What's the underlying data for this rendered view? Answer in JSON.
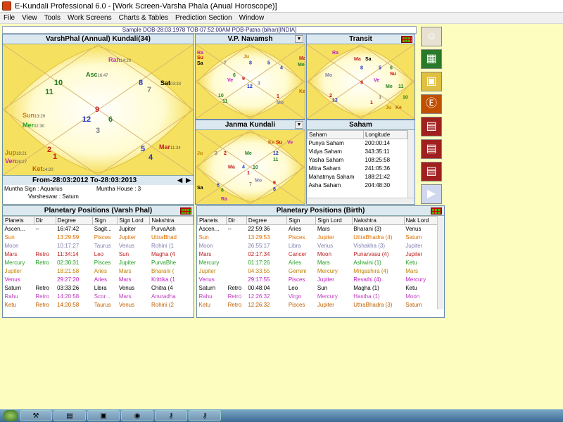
{
  "window": {
    "title": "E-Kundali Professional 6.0 - [Work Screen-Varsha Phala (Anual Horoscope)]"
  },
  "menu": [
    "File",
    "View",
    "Tools",
    "Work Screens",
    "Charts & Tables",
    "Prediction Section",
    "Window"
  ],
  "sample_line": "Sample DOB-28:03:1978 TOB-07:52:00AM POB-Patna (bihar)[INDIA]",
  "varshphal": {
    "title": "VarshPhal (Annual) Kundali(34)",
    "houses": [
      "9",
      "7",
      "8",
      "12",
      "6",
      "3",
      "5",
      "4",
      "1",
      "2",
      "11",
      "10"
    ],
    "planets": [
      {
        "t": "Rah",
        "deg": "14:20",
        "c": "#c040c0"
      },
      {
        "t": "Asc",
        "deg": "16:47",
        "c": "#208020"
      },
      {
        "t": "Sat",
        "deg": "03:33",
        "c": "#000000"
      },
      {
        "t": "Sun",
        "deg": "13:29",
        "c": "#e07000"
      },
      {
        "t": "Mer",
        "deg": "02:30",
        "c": "#20a020"
      },
      {
        "t": "Mar",
        "deg": "11:34",
        "c": "#c02020"
      },
      {
        "t": "Jup",
        "deg": "18:21",
        "c": "#c08000"
      },
      {
        "t": "Ven",
        "deg": "29:27",
        "c": "#c020c0"
      },
      {
        "t": "Ket",
        "deg": "14:20",
        "c": "#c06000"
      },
      {
        "t": "Moo",
        "deg": "10:17",
        "c": "#8080b0"
      }
    ],
    "period": "From-28:03:2012 To-28:03:2013",
    "muntha_sign": "Muntha Sign : Aquarius",
    "muntha_house": "Muntha House : 3",
    "varsheswar": "Varsheswar : Saturn"
  },
  "navamsh": {
    "title": "V.P. Navamsh"
  },
  "transit": {
    "title": "Transit"
  },
  "janma": {
    "title": "Janma Kundali"
  },
  "saham": {
    "title": "Saham",
    "headers": [
      "Saham",
      "Longitude"
    ],
    "rows": [
      [
        "Punya Saham",
        "200:00:14"
      ],
      [
        "Vidya Saham",
        "343:35:11"
      ],
      [
        "Yasha Saham",
        "108:25:58"
      ],
      [
        "Mitra Saham",
        "241:05:36"
      ],
      [
        "Mahatmya Saham",
        "188:21:42"
      ],
      [
        "Asha Saham",
        "204:48:30"
      ]
    ]
  },
  "pp_varsh": {
    "title": "Planetary Positions (Varsh Phal)",
    "headers": [
      "Planets",
      "Dir",
      "Degree",
      "Sign",
      "Sign Lord",
      "Nakshtra"
    ],
    "rows": [
      {
        "c": "#000000",
        "v": [
          "Ascen...",
          "--",
          "16:47:42",
          "Sagit...",
          "Jupiter",
          "PurvaAsh"
        ]
      },
      {
        "c": "#e07000",
        "v": [
          "Sun",
          "",
          "13:29:59",
          "Pisces",
          "Jupiter",
          "UttraBhad"
        ]
      },
      {
        "c": "#8080b0",
        "v": [
          "Moon",
          "",
          "10:17:27",
          "Taurus",
          "Venus",
          "Rohini (1"
        ]
      },
      {
        "c": "#c02020",
        "v": [
          "Mars",
          "Retro",
          "11:34:14",
          "Leo",
          "Sun",
          "Magha (4"
        ]
      },
      {
        "c": "#20a020",
        "v": [
          "Mercury",
          "Retro",
          "02:30:31",
          "Pisces",
          "Jupiter",
          "PurvaBhe"
        ]
      },
      {
        "c": "#c08000",
        "v": [
          "Jupiter",
          "",
          "18:21:58",
          "Aries",
          "Mars",
          "Bharani ("
        ]
      },
      {
        "c": "#c020c0",
        "v": [
          "Venus",
          "",
          "29:27:20",
          "Aries",
          "Mars",
          "Krittika (1"
        ]
      },
      {
        "c": "#000000",
        "v": [
          "Saturn",
          "Retro",
          "03:33:26",
          "Libra",
          "Venus",
          "Chitra (4"
        ]
      },
      {
        "c": "#c040c0",
        "v": [
          "Rahu",
          "Retro",
          "14:20:58",
          "Scor...",
          "Mars",
          "Anuradha"
        ]
      },
      {
        "c": "#c06000",
        "v": [
          "Ketu",
          "Retro",
          "14:20:58",
          "Taurus",
          "Venus",
          "Rohini (2"
        ]
      }
    ]
  },
  "pp_birth": {
    "title": "Planetary Positions (Birth)",
    "headers": [
      "Planets",
      "Dir",
      "Degree",
      "Sign",
      "Sign Lord",
      "Nakshtra",
      "Nak Lord"
    ],
    "rows": [
      {
        "c": "#000000",
        "v": [
          "Ascen...",
          "--",
          "22:59:36",
          "Aries",
          "Mars",
          "Bharani (3)",
          "Venus"
        ]
      },
      {
        "c": "#e07000",
        "v": [
          "Sun",
          "",
          "13:29:53",
          "Pisces",
          "Jupiter",
          "UttraBhadra (4)",
          "Saturn"
        ]
      },
      {
        "c": "#8080b0",
        "v": [
          "Moon",
          "",
          "26:55:17",
          "Libra",
          "Venus",
          "Vishakha (3)",
          "Jupiter"
        ]
      },
      {
        "c": "#c02020",
        "v": [
          "Mars",
          "",
          "02:17:34",
          "Cancer",
          "Moon",
          "Punarvasu (4)",
          "Jupiter"
        ]
      },
      {
        "c": "#20a020",
        "v": [
          "Mercury",
          "",
          "01:17:26",
          "Aries",
          "Mars",
          "Ashwini (1)",
          "Ketu"
        ]
      },
      {
        "c": "#c08000",
        "v": [
          "Jupiter",
          "",
          "04:33:55",
          "Gemini",
          "Mercury",
          "Mrigashira (4)",
          "Mars"
        ]
      },
      {
        "c": "#c020c0",
        "v": [
          "Venus",
          "",
          "29:17:55",
          "Pisces",
          "Jupiter",
          "Revathi (4)",
          "Mercury"
        ]
      },
      {
        "c": "#000000",
        "v": [
          "Saturn",
          "Retro",
          "00:48:04",
          "Leo",
          "Sun",
          "Magha (1)",
          "Ketu"
        ]
      },
      {
        "c": "#c040c0",
        "v": [
          "Rahu",
          "Retro",
          "12:26:32",
          "Virgo",
          "Mercury",
          "Hastha (1)",
          "Moon"
        ]
      },
      {
        "c": "#c06000",
        "v": [
          "Ketu",
          "Retro",
          "12:26:32",
          "Pisces",
          "Jupiter",
          "UttraBhadra (3)",
          "Saturn"
        ]
      }
    ]
  },
  "side_icons": [
    "kundali-person-icon",
    "calendar-grid-icon",
    "book-icon",
    "e-coin-icon",
    "chart-table-icon",
    "chart-table-2-icon",
    "chart-table-3-icon",
    "video-icon"
  ]
}
